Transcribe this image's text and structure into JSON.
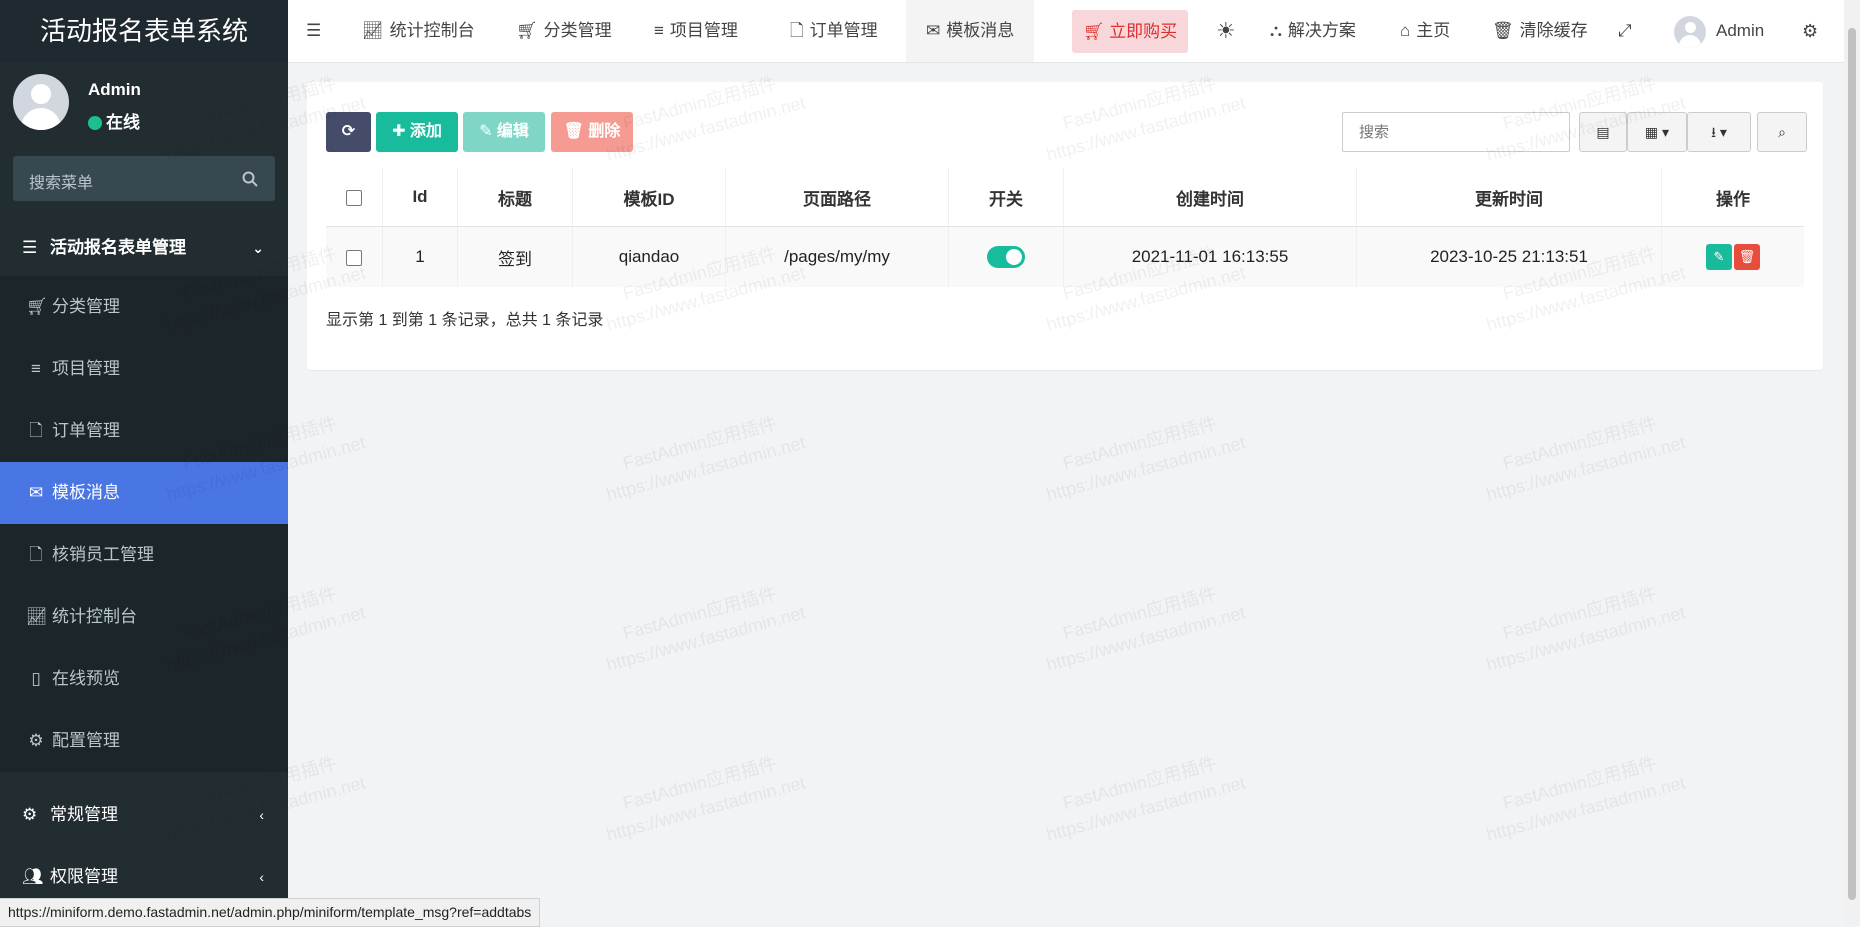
{
  "app": {
    "title": "活动报名表单系统"
  },
  "user": {
    "name": "Admin",
    "status": "在线"
  },
  "sidebar": {
    "search_placeholder": "搜索菜单",
    "group_main": "活动报名表单管理",
    "items": [
      {
        "label": "分类管理",
        "icon": "cart-icon"
      },
      {
        "label": "项目管理",
        "icon": "list-icon"
      },
      {
        "label": "订单管理",
        "icon": "file-icon"
      },
      {
        "label": "模板消息",
        "icon": "envelope-icon"
      },
      {
        "label": "核销员工管理",
        "icon": "file-icon"
      },
      {
        "label": "统计控制台",
        "icon": "chart-icon"
      },
      {
        "label": "在线预览",
        "icon": "mobile-icon"
      },
      {
        "label": "配置管理",
        "icon": "cogs-icon"
      }
    ],
    "group_general": "常规管理",
    "group_auth": "权限管理"
  },
  "header": {
    "tabs": [
      {
        "label": "统计控制台"
      },
      {
        "label": "分类管理"
      },
      {
        "label": "项目管理"
      },
      {
        "label": "订单管理"
      },
      {
        "label": "模板消息"
      }
    ],
    "buy_label": "立即购买",
    "solutions_label": "解决方案",
    "home_label": "主页",
    "clear_cache_label": "清除缓存",
    "user_name": "Admin"
  },
  "toolbar": {
    "add_label": "添加",
    "edit_label": "编辑",
    "delete_label": "删除",
    "search_placeholder": "搜索"
  },
  "table": {
    "columns": [
      "Id",
      "标题",
      "模板ID",
      "页面路径",
      "开关",
      "创建时间",
      "更新时间",
      "操作"
    ],
    "rows": [
      {
        "id": "1",
        "title": "签到",
        "template_id": "qiandao",
        "path": "/pages/my/my",
        "switch_on": true,
        "created": "2021-11-01 16:13:55",
        "updated": "2023-10-25 21:13:51"
      }
    ],
    "summary": "显示第 1 到第 1 条记录，总共 1 条记录"
  },
  "watermark": {
    "line1": "FastAdmin应用插件",
    "line2": "https://www.fastadmin.net"
  },
  "status_bar": {
    "url": "https://miniform.demo.fastadmin.net/admin.php/miniform/template_msg?ref=addtabs"
  },
  "colors": {
    "sidebar_bg": "#222d32",
    "active_item": "#4a76e4",
    "success": "#18bc9c",
    "danger": "#e74c3c",
    "primary_dark": "#444c69"
  }
}
